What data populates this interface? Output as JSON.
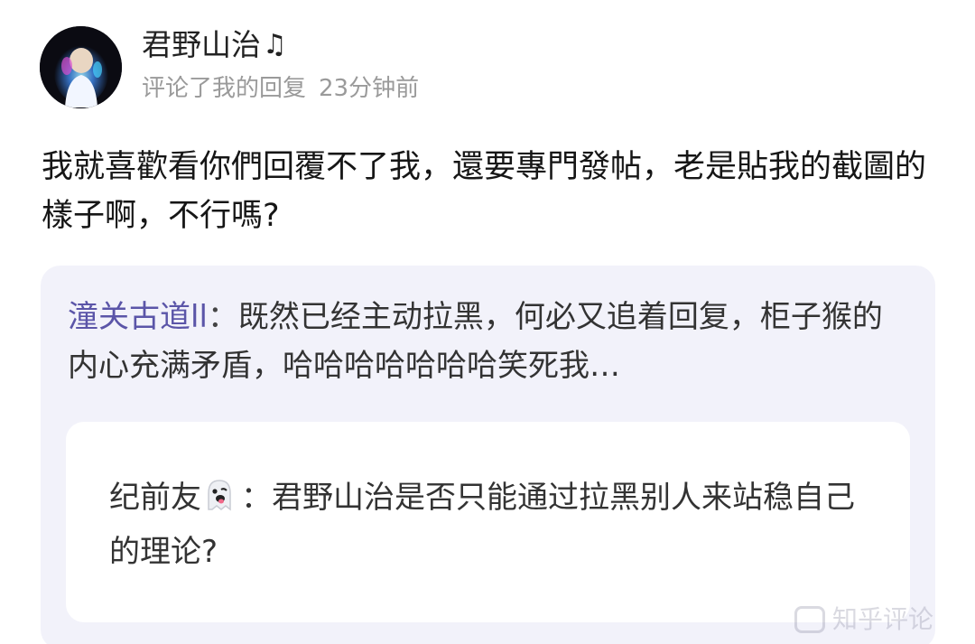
{
  "comment": {
    "username": "君野山治",
    "username_icon": "music-note-icon",
    "action": "评论了我的回复",
    "time": "23分钟前",
    "text": "我就喜歡看你們回覆不了我，還要專門發帖，老是貼我的截圖的樣子啊，不行嗎?"
  },
  "quote": {
    "author": "潼关古道ll",
    "separator": "：",
    "text": "既然已经主动拉黑，何必又追着回复，柜子猴的内心充满矛盾，哈哈哈哈哈哈哈笑死我…",
    "nested": {
      "author": "纪前友",
      "author_icon": "ghost-emoji-icon",
      "separator": "：",
      "text": "君野山治是否只能通过拉黑别人来站稳自己的理论?"
    }
  },
  "watermark": {
    "text": "知乎评论"
  },
  "colors": {
    "author_accent": "#5b55a8",
    "quote_background": "#f2f2fa",
    "meta_gray": "#9a9a9a"
  }
}
